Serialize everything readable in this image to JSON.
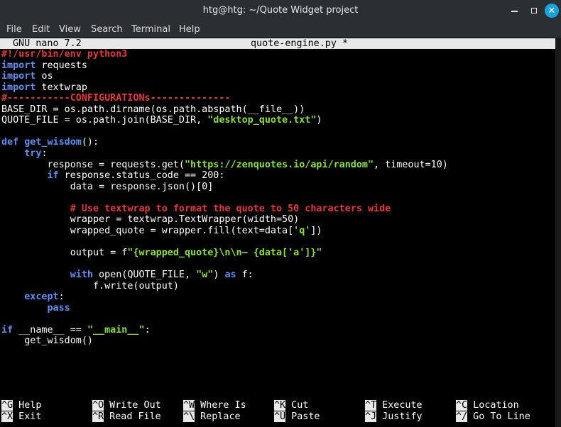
{
  "window": {
    "title": "htg@htg: ~/Quote Widget project",
    "minimize_glyph": "",
    "maximize_glyph": "",
    "close_glyph": "✕"
  },
  "menu": [
    "File",
    "Edit",
    "View",
    "Search",
    "Terminal",
    "Help"
  ],
  "nano": {
    "version": "GNU nano 7.2",
    "filename": "quote-engine.py *"
  },
  "code": [
    [
      {
        "c": "cm",
        "t": "#!/usr/bin/env python3"
      }
    ],
    [
      {
        "c": "kw",
        "t": "import"
      },
      {
        "c": "pl",
        "t": " requests"
      }
    ],
    [
      {
        "c": "kw",
        "t": "import"
      },
      {
        "c": "pl",
        "t": " os"
      }
    ],
    [
      {
        "c": "kw",
        "t": "import"
      },
      {
        "c": "pl",
        "t": " textwrap"
      }
    ],
    [
      {
        "c": "cm",
        "t": "#-----------CONFIGURATIONs--------------"
      }
    ],
    [
      {
        "c": "pl",
        "t": "BASE_DIR = os.path.dirname(os.path.abspath(__file__))"
      }
    ],
    [
      {
        "c": "pl",
        "t": "QUOTE_FILE = os.path.join(BASE_DIR, "
      },
      {
        "c": "str",
        "t": "\"desktop_quote.txt\""
      },
      {
        "c": "pl",
        "t": ")"
      }
    ],
    [],
    [
      {
        "c": "kw",
        "t": "def"
      },
      {
        "c": "pl",
        "t": " "
      },
      {
        "c": "kw",
        "t": "get_wisdom"
      },
      {
        "c": "pl",
        "t": "():"
      }
    ],
    [
      {
        "c": "pl",
        "t": "    "
      },
      {
        "c": "kw",
        "t": "try"
      },
      {
        "c": "pl",
        "t": ":"
      }
    ],
    [
      {
        "c": "pl",
        "t": "        response = requests.get("
      },
      {
        "c": "str",
        "t": "\"https://zenquotes.io/api/random\""
      },
      {
        "c": "pl",
        "t": ", timeout=10)"
      }
    ],
    [
      {
        "c": "pl",
        "t": "        "
      },
      {
        "c": "kw",
        "t": "if"
      },
      {
        "c": "pl",
        "t": " response.status_code == 200:"
      }
    ],
    [
      {
        "c": "pl",
        "t": "            data = response.json()[0]"
      }
    ],
    [],
    [
      {
        "c": "pl",
        "t": "            "
      },
      {
        "c": "cm",
        "t": "# Use textwrap to format the quote to 50 characters wide"
      }
    ],
    [
      {
        "c": "pl",
        "t": "            wrapper = textwrap.TextWrapper(width=50)"
      }
    ],
    [
      {
        "c": "pl",
        "t": "            wrapped_quote = wrapper.fill(text=data["
      },
      {
        "c": "str",
        "t": "'q'"
      },
      {
        "c": "pl",
        "t": "])"
      }
    ],
    [],
    [
      {
        "c": "pl",
        "t": "            output = f"
      },
      {
        "c": "str",
        "t": "\"{wrapped_quote}\\n\\n— {data['a']}\""
      }
    ],
    [],
    [
      {
        "c": "pl",
        "t": "            "
      },
      {
        "c": "kw",
        "t": "with"
      },
      {
        "c": "pl",
        "t": " open(QUOTE_FILE, "
      },
      {
        "c": "str",
        "t": "\"w\""
      },
      {
        "c": "pl",
        "t": ") "
      },
      {
        "c": "kw",
        "t": "as"
      },
      {
        "c": "pl",
        "t": " f:"
      }
    ],
    [
      {
        "c": "pl",
        "t": "                f.write(output)"
      }
    ],
    [
      {
        "c": "pl",
        "t": "    "
      },
      {
        "c": "kw",
        "t": "except"
      },
      {
        "c": "pl",
        "t": ":"
      }
    ],
    [
      {
        "c": "pl",
        "t": "        "
      },
      {
        "c": "kw",
        "t": "pass"
      }
    ],
    [],
    [
      {
        "c": "kw",
        "t": "if"
      },
      {
        "c": "pl",
        "t": " __name__ == "
      },
      {
        "c": "str",
        "t": "\"__main__\""
      },
      {
        "c": "pl",
        "t": ":"
      }
    ],
    [
      {
        "c": "pl",
        "t": "    get_wisdom()"
      }
    ]
  ],
  "shortcuts": [
    {
      "key": "^G",
      "label": "Help"
    },
    {
      "key": "^O",
      "label": "Write Out"
    },
    {
      "key": "^W",
      "label": "Where Is"
    },
    {
      "key": "^K",
      "label": "Cut"
    },
    {
      "key": "^T",
      "label": "Execute"
    },
    {
      "key": "^C",
      "label": "Location"
    },
    {
      "key": "^X",
      "label": "Exit"
    },
    {
      "key": "^R",
      "label": "Read File"
    },
    {
      "key": "^\\",
      "label": "Replace"
    },
    {
      "key": "^U",
      "label": "Paste"
    },
    {
      "key": "^J",
      "label": "Justify"
    },
    {
      "key": "^/",
      "label": "Go To Line"
    }
  ],
  "colors": {
    "keyword": "#5c8ff5",
    "string": "#8ae234",
    "comment": "#e8363a",
    "titlebar": "#2b2e33",
    "close_button": "#17a2e0"
  }
}
